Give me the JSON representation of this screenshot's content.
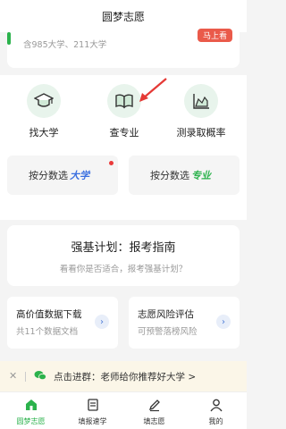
{
  "header": {
    "title": "圆梦志愿"
  },
  "top_card": {
    "subtitle": "含985大学、211大学",
    "tag": "马上看"
  },
  "quick_actions": [
    {
      "label": "找大学",
      "icon": "graduation-cap-icon"
    },
    {
      "label": "查专业",
      "icon": "open-book-icon"
    },
    {
      "label": "测录取概率",
      "icon": "chart-icon"
    }
  ],
  "score_select": [
    {
      "prefix": "按分数选",
      "accent": "大学",
      "accent_color": "#3a6fe0"
    },
    {
      "prefix": "按分数选",
      "accent": "专业",
      "accent_color": "#2bb24c"
    }
  ],
  "plan": {
    "title": "强基计划：报考指南",
    "subtitle": "看看你是否适合，报考强基计划？"
  },
  "features": [
    {
      "title": "高价值数据下载",
      "subtitle": "共11个数据文档"
    },
    {
      "title": "志愿风险评估",
      "subtitle": "可预警落榜风险"
    }
  ],
  "notice": {
    "text": "点击进群：老师给你推荐好大学 >"
  },
  "tabs": [
    {
      "label": "圆梦志愿",
      "active": true
    },
    {
      "label": "填报速学",
      "active": false
    },
    {
      "label": "填志愿",
      "active": false
    },
    {
      "label": "我的",
      "active": false
    }
  ],
  "colors": {
    "brand_green": "#2bb24c",
    "alert_red": "#ea3b3b",
    "accent_blue": "#3a6fe0"
  }
}
